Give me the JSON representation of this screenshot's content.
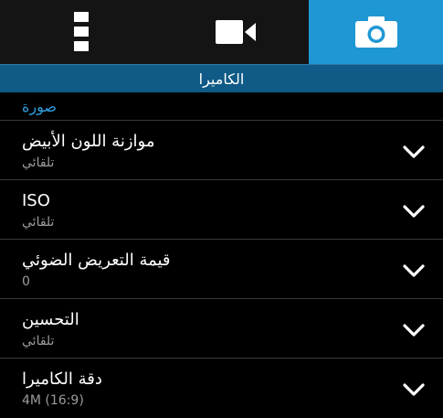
{
  "tabs": [
    {
      "icon": "more-vertical-icon",
      "active": false
    },
    {
      "icon": "video-camera-icon",
      "active": false
    },
    {
      "icon": "camera-icon",
      "active": true
    }
  ],
  "header": {
    "title": "الكاميرا"
  },
  "section": {
    "title": "صورة"
  },
  "settings": [
    {
      "title": "موازنة اللون الأبيض",
      "value": "تلقائي"
    },
    {
      "title": "ISO",
      "value": "تلقائي"
    },
    {
      "title": "قيمة التعريض الضوئي",
      "value": "0"
    },
    {
      "title": "التحسين",
      "value": "تلقائي"
    },
    {
      "title": "دقة الكاميرا",
      "value": "4M (16:9)"
    }
  ],
  "colors": {
    "accent": "#1f97d4",
    "title_bar": "#0f5a86",
    "section_text": "#2f9ee0",
    "background": "#000000"
  }
}
